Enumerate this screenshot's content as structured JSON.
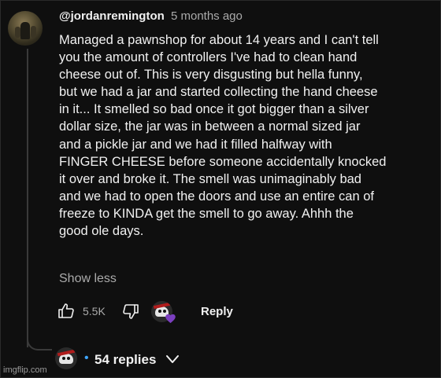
{
  "comment": {
    "author": "@jordanremington",
    "time": "5 months ago",
    "body_lines": [
      "Managed a pawnshop for about 14 years and I can't tell",
      "you the amount of controllers I've had to clean hand",
      "cheese out of. This is very disgusting but hella funny,",
      "but we had a jar and started collecting the hand cheese",
      "in it... It smelled so bad once it got bigger than a silver",
      "dollar size, the jar was in between a normal sized jar",
      "and a pickle jar and we had it filled halfway with",
      "FINGER CHEESE before someone accidentally knocked",
      "it over and broke it. The smell was unimaginably bad",
      "and we had to open the doors and use an entire can of",
      "freeze to KINDA get the smell to go away. Ahhh the",
      "good ole days."
    ],
    "show_less_label": "Show less"
  },
  "actions": {
    "like_count": "5.5K",
    "reply_label": "Reply",
    "like_icon": "thumbs-up-icon",
    "dislike_icon": "thumbs-down-icon",
    "heart_color": "#7b3fbf"
  },
  "replies": {
    "dot": "•",
    "count_label": "54 replies",
    "accent": "#3ea6ff"
  },
  "watermark": "imgflip.com"
}
